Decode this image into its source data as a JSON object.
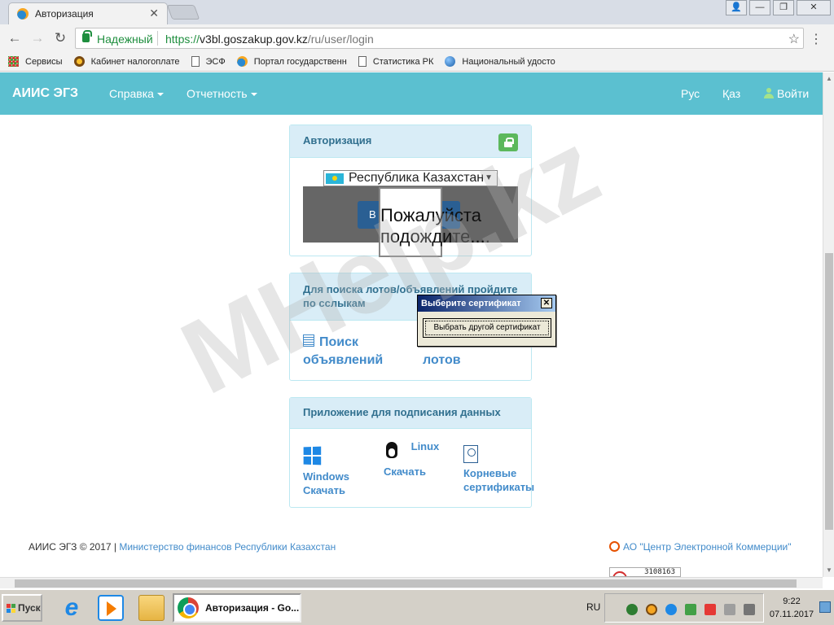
{
  "browser": {
    "tab_title": "Авторизация",
    "secure_label": "Надежный",
    "url_scheme": "https://",
    "url_host": "v3bl.goszakup.gov.kz",
    "url_path": "/ru/user/login",
    "bookmarks": [
      {
        "label": "Сервисы",
        "icon": "apps-icon"
      },
      {
        "label": "Кабинет налогоплате",
        "icon": "gear-icon"
      },
      {
        "label": "ЭСФ",
        "icon": "document-icon"
      },
      {
        "label": "Портал государственн",
        "icon": "sun-icon"
      },
      {
        "label": "Статистика РК",
        "icon": "document-icon"
      },
      {
        "label": "Национальный удосто",
        "icon": "globe-icon"
      }
    ]
  },
  "navbar": {
    "brand": "АИИС ЭГЗ",
    "menu": [
      {
        "label": "Справка"
      },
      {
        "label": "Отчетность"
      }
    ],
    "lang_ru": "Рус",
    "lang_kz": "Қаз",
    "login": "Войти"
  },
  "auth_panel": {
    "title": "Авторизация",
    "country": "Республика Казахстан",
    "button_partial": "В",
    "wait_text": "Пожалуйста подождите...."
  },
  "cert_dialog": {
    "title": "Выберите сертификат",
    "button": "Выбрать другой сертификат"
  },
  "search_panel": {
    "title": "Для поиска лотов/объявлений пройдите по сслыкам",
    "link1": "Поиск объявлений",
    "link2": "лотов"
  },
  "signing_panel": {
    "title": "Приложение для подписания данных",
    "windows_name": "Windows",
    "windows_action": "Скачать",
    "linux_name": "Linux",
    "linux_action": "Скачать",
    "certs_line1": "Корневые",
    "certs_line2": "сертификаты"
  },
  "footer": {
    "copyright": "АИИС ЭГЗ © 2017 | ",
    "ministry": "Министерство финансов Республики Казахстан",
    "ecc": "АО \"Центр Электронной Коммерции\"",
    "counter": "3108163"
  },
  "watermark": "MHelp.kz",
  "taskbar": {
    "start": "Пуск",
    "task_item": "Авторизация - Go...",
    "lang": "RU",
    "time": "9:22",
    "date": "07.11.2017"
  },
  "colors": {
    "navbar": "#5bc0d0",
    "panel_header": "#d9edf7",
    "link": "#428bca",
    "secure": "#1e8e3e"
  }
}
